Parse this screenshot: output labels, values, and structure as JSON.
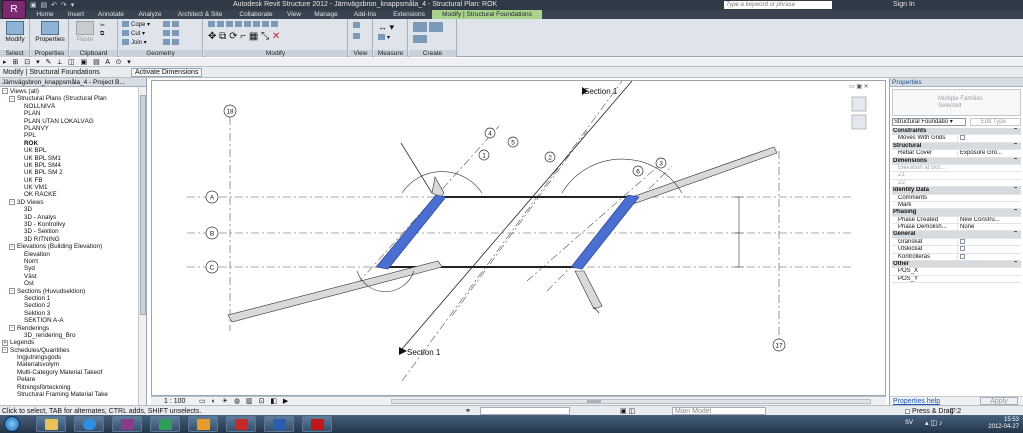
{
  "app": {
    "menu_glyph": "R",
    "title": "Autodesk Revit Structure 2012 -    Järnvägsbron_knappsmåla_4 - Structural Plan: RÖK",
    "search_placeholder": "Type a keyword or phrase",
    "sign_in": "Sign In"
  },
  "ribbon_tabs": [
    "Home",
    "Insert",
    "Annotate",
    "Analyze",
    "Architect & Site",
    "Collaborate",
    "View",
    "Manage",
    "Add-Ins",
    "Extensions",
    "Modify | Structural Foundations"
  ],
  "ribbon": {
    "select": {
      "button": "Modify",
      "label": "Select"
    },
    "properties": {
      "button": "Properties",
      "label": "Properties"
    },
    "clipboard": {
      "paste": "Paste",
      "label": "Clipboard"
    },
    "geometry": {
      "cope": "Cope",
      "cut": "Cut",
      "join": "Join",
      "label": "Geometry"
    },
    "modify_label": "Modify",
    "view_label": "View",
    "measure_label": "Measure",
    "create_label": "Create"
  },
  "context_bar": {
    "label": "Modify | Structural Foundations",
    "activate_dimensions": "Activate Dimensions"
  },
  "project_browser": {
    "title": "Järnvägsbron_knappsmåla_4 - Project B...",
    "items": [
      {
        "label": "Views (all)",
        "level": 0,
        "toggle": "-"
      },
      {
        "label": "Structural Plans (Structural Plan",
        "level": 1,
        "toggle": "-"
      },
      {
        "label": "NOLLNIVÅ",
        "level": 2
      },
      {
        "label": "PLAN",
        "level": 2
      },
      {
        "label": "PLAN UTAN LOKALVÄG",
        "level": 2
      },
      {
        "label": "PLANVY",
        "level": 2
      },
      {
        "label": "PPL",
        "level": 2
      },
      {
        "label": "RÖK",
        "level": 2,
        "bold": true
      },
      {
        "label": "UK BPL",
        "level": 2
      },
      {
        "label": "UK BPL SM1",
        "level": 2
      },
      {
        "label": "UK BPL SM4",
        "level": 2
      },
      {
        "label": "UK BPL SM 2",
        "level": 2
      },
      {
        "label": "UK FB",
        "level": 2
      },
      {
        "label": "UK VM1",
        "level": 2
      },
      {
        "label": "ÖK RÄCKE",
        "level": 2
      },
      {
        "label": "3D Views",
        "level": 1,
        "toggle": "-"
      },
      {
        "label": "3D",
        "level": 2
      },
      {
        "label": "3D - Analys",
        "level": 2
      },
      {
        "label": "3D - Kontrollvy",
        "level": 2
      },
      {
        "label": "3D - Sektion",
        "level": 2
      },
      {
        "label": "3D RITNING",
        "level": 2
      },
      {
        "label": "Elevations (Building Elevation)",
        "level": 1,
        "toggle": "-"
      },
      {
        "label": "Elevation",
        "level": 2
      },
      {
        "label": "Norrt",
        "level": 2
      },
      {
        "label": "Syd",
        "level": 2
      },
      {
        "label": "Väst",
        "level": 2
      },
      {
        "label": "Öst",
        "level": 2
      },
      {
        "label": "Sections (Huvudsektion)",
        "level": 1,
        "toggle": "-"
      },
      {
        "label": "Section 1",
        "level": 2
      },
      {
        "label": "Section 2",
        "level": 2
      },
      {
        "label": "Sektion 3",
        "level": 2
      },
      {
        "label": "SEKTION A-A",
        "level": 2
      },
      {
        "label": "Renderings",
        "level": 1,
        "toggle": "-"
      },
      {
        "label": "3D_rendering_Bro",
        "level": 2
      },
      {
        "label": "Legends",
        "level": 0,
        "toggle": "+"
      },
      {
        "label": "Schedules/Quantities",
        "level": 0,
        "toggle": "-"
      },
      {
        "label": "Ingjutningsgods",
        "level": 1
      },
      {
        "label": "Materialsvolym",
        "level": 1
      },
      {
        "label": "Multi-Category Material Takeof",
        "level": 1
      },
      {
        "label": "Pelare",
        "level": 1
      },
      {
        "label": "Ritningsförteckning",
        "level": 1
      },
      {
        "label": "Structural Framing Material Take",
        "level": 1
      }
    ]
  },
  "canvas": {
    "section_label_top": "Section 1",
    "section_label_bottom": "Section 1",
    "grid_A": "A",
    "grid_B": "B",
    "grid_C": "C",
    "grid_left": "18",
    "grid_right": "17",
    "callouts": [
      "4",
      "5",
      "1",
      "2",
      "6",
      "3"
    ]
  },
  "view_bar": {
    "scale": "1 : 100"
  },
  "properties": {
    "title": "Properties",
    "type_name": "Multiple Families Selected",
    "type_selector": "Structural Foundatio",
    "edit_type": "Edit Type",
    "rows": [
      {
        "cat": "Constraints"
      },
      {
        "k": "Moves With Grids",
        "v": "",
        "check": true
      },
      {
        "cat": "Structural"
      },
      {
        "k": "Rebar Cover",
        "v": "Exposure Gro..."
      },
      {
        "cat": "Dimensions"
      },
      {
        "k": "Elevation at Bot...",
        "v": "",
        "gray": true
      },
      {
        "k": "Z1",
        "v": "",
        "gray": true
      },
      {
        "k": "Z2",
        "v": "",
        "gray": true
      },
      {
        "cat": "Identity Data"
      },
      {
        "k": "Comments",
        "v": ""
      },
      {
        "k": "Mark",
        "v": ""
      },
      {
        "cat": "Phasing"
      },
      {
        "k": "Phase Created",
        "v": "New Constru..."
      },
      {
        "k": "Phase Demolish...",
        "v": "None"
      },
      {
        "cat": "General"
      },
      {
        "k": "Granskat",
        "v": "",
        "check": true
      },
      {
        "k": "Utskickat",
        "v": "",
        "check": true
      },
      {
        "k": "Kontrolleras",
        "v": "",
        "check": true
      },
      {
        "cat": "Other"
      },
      {
        "k": "POS_X",
        "v": ""
      },
      {
        "k": "POS_Y",
        "v": ""
      }
    ],
    "help": "Properties help",
    "apply": "Apply"
  },
  "status": {
    "message": "Click to select, TAB for alternates, CTRL adds, SHIFT unselects.",
    "model": "Main Model",
    "press_drag": "Press & Drag",
    "filter_count": ":2"
  },
  "taskbar": {
    "lang": "SV",
    "time": "15:53",
    "date": "2012-04-27"
  },
  "colors": {
    "foundation": "#4a6fd0",
    "ribbon_context": "#a9d28c",
    "title_bg": "#2f3a46"
  }
}
